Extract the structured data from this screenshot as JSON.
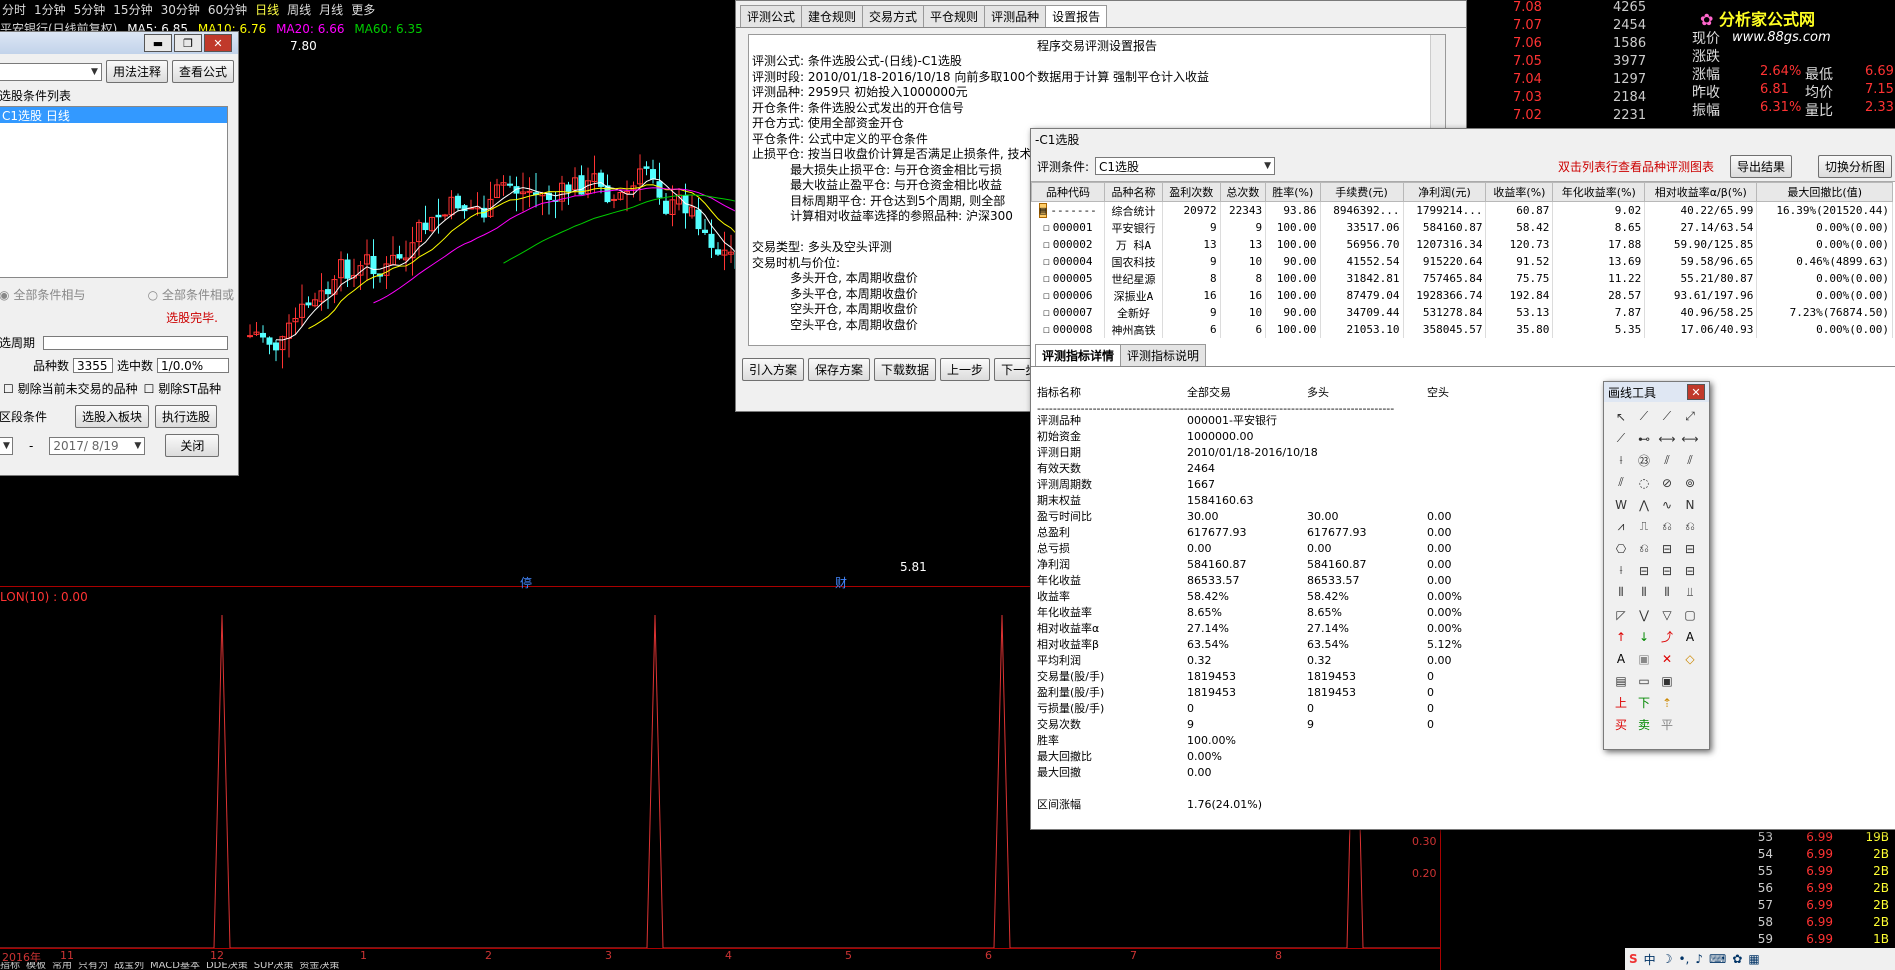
{
  "period_bar": {
    "items": [
      "分时",
      "1分钟",
      "5分钟",
      "15分钟",
      "30分钟",
      "60分钟",
      "日线",
      "周线",
      "月线",
      "更多"
    ],
    "active": "日线"
  },
  "ma_legend": {
    "title": "平安银行(日线前复权)",
    "ma5": "MA5: 6.85",
    "ma10": "MA10: 6.76",
    "ma20": "MA20: 6.66",
    "ma60": "MA60: 6.35"
  },
  "kline": {
    "high_label": "7.80",
    "low_label": "5.81",
    "date_start": "2016年",
    "months": [
      "11",
      "12",
      "1",
      "2",
      "3",
      "4",
      "5",
      "6",
      "7",
      "8"
    ],
    "event_marks": [
      "停",
      "财"
    ]
  },
  "indicator": {
    "label": "LON(10) : 0.00",
    "ticks": [
      "0.30",
      "0.20"
    ]
  },
  "bottom_tabs": [
    "指标",
    "模板",
    "常用",
    "只有为",
    "战宝列",
    "MACD基本",
    "DDE决策",
    "SUP决策",
    "资金决策"
  ],
  "select_window": {
    "buttons": {
      "usage": "用法注释",
      "view": "查看公式",
      "add": "选股入板块",
      "exec": "执行选股",
      "close": "关闭"
    },
    "list_header": "选股条件列表",
    "list_item": "C1选股  日线",
    "radio_and": "全部条件相与",
    "radio_or": "全部条件相或",
    "status": "选股完毕.",
    "period_label": "选周期",
    "count_label": "品种数",
    "count_value": "3355",
    "selected_label": "选中数",
    "selected_value": "1/0.0%",
    "check1": "剔除当前未交易的品种",
    "check2": "剔除ST品种",
    "cond_label": "区段条件",
    "dash": "-",
    "date_end": "2017/ 8/19"
  },
  "report_window": {
    "tabs": [
      "评测公式",
      "建仓规则",
      "交易方式",
      "平仓规则",
      "评测品种",
      "设置报告"
    ],
    "active_tab": "设置报告",
    "heading": "程序交易评测设置报告",
    "lines": [
      "评测公式: 条件选股公式-(日线)-C1选股",
      "评测时段: 2010/01/18-2016/10/18 向前多取100个数据用于计算 强制平仓计入收益",
      "评测品种: 2959只 初始投入1000000元",
      "开仓条件: 条件选股公式发出的开仓信号",
      "开仓方式: 使用全部资金开仓",
      "平仓条件: 公式中定义的平仓条件",
      "止损平仓: 按当日收盘价计算是否满足止损条件, 技术",
      "          最大损失止损平仓: 与开仓资金相比亏损",
      "          最大收益止盈平仓: 与开仓资金相比收益",
      "          目标周期平仓: 开仓达到5个周期, 则全部",
      "          计算相对收益率选择的参照品种: 沪深300",
      "",
      "交易类型: 多头及空头评测",
      "交易时机与价位:",
      "          多头开仓, 本周期收盘价",
      "          多头平仓, 本周期收盘价",
      "          空头开仓, 本周期收盘价",
      "          空头平仓, 本周期收盘价"
    ],
    "buttons": [
      "引入方案",
      "保存方案",
      "下载数据",
      "上一步",
      "下一步"
    ]
  },
  "result_window": {
    "title": "-C1选股",
    "cond_label": "评测条件:",
    "cond_value": "C1选股",
    "hint": "双击列表行查看品种评测图表",
    "export": "导出结果",
    "switch": "切换分析图",
    "columns": [
      "品种代码",
      "品种名称",
      "盈利次数",
      "总次数",
      "胜率(%)",
      "手续费(元)",
      "净利润(元)",
      "收益率(%)",
      "年化收益率(%)",
      "相对收益率α/β(%)",
      "最大回撤比(值)"
    ],
    "rows": [
      [
        "-------",
        "综合统计",
        "20972",
        "22343",
        "93.86",
        "8946392...",
        "1799214...",
        "60.87",
        "9.02",
        "40.22/65.99",
        "16.39%(201520.44)"
      ],
      [
        "000001",
        "平安银行",
        "9",
        "9",
        "100.00",
        "33517.06",
        "584160.87",
        "58.42",
        "8.65",
        "27.14/63.54",
        "0.00%(0.00)"
      ],
      [
        "000002",
        "万 科A",
        "13",
        "13",
        "100.00",
        "56956.70",
        "1207316.34",
        "120.73",
        "17.88",
        "59.90/125.85",
        "0.00%(0.00)"
      ],
      [
        "000004",
        "国农科技",
        "9",
        "10",
        "90.00",
        "41552.54",
        "915220.64",
        "91.52",
        "13.69",
        "59.58/96.65",
        "0.46%(4899.63)"
      ],
      [
        "000005",
        "世纪星源",
        "8",
        "8",
        "100.00",
        "31842.81",
        "757465.84",
        "75.75",
        "11.22",
        "55.21/80.87",
        "0.00%(0.00)"
      ],
      [
        "000006",
        "深振业A",
        "16",
        "16",
        "100.00",
        "87479.04",
        "1928366.74",
        "192.84",
        "28.57",
        "93.61/197.96",
        "0.00%(0.00)"
      ],
      [
        "000007",
        "全新好",
        "9",
        "10",
        "90.00",
        "34709.44",
        "531278.84",
        "53.13",
        "7.87",
        "40.96/58.25",
        "7.23%(76874.50)"
      ],
      [
        "000008",
        "神州高铁",
        "6",
        "6",
        "100.00",
        "21053.10",
        "358045.57",
        "35.80",
        "5.35",
        "17.06/40.93",
        "0.00%(0.00)"
      ]
    ],
    "tabs2": [
      "评测指标详情",
      "评测指标说明"
    ],
    "detail_header": [
      "指标名称",
      "全部交易",
      "多头",
      "空头"
    ],
    "divider": "------------------------------------------------------------------------------------------",
    "detail_rows": [
      [
        "评测品种",
        "000001-平安银行",
        "",
        ""
      ],
      [
        "初始资金",
        "1000000.00",
        "",
        ""
      ],
      [
        "评测日期",
        "2010/01/18-2016/10/18",
        "",
        ""
      ],
      [
        "有效天数",
        "2464",
        "",
        ""
      ],
      [
        "评测周期数",
        "1667",
        "",
        ""
      ],
      [
        "期末权益",
        "1584160.63",
        "",
        ""
      ],
      [
        "盈亏时间比",
        "30.00",
        "30.00",
        "0.00"
      ],
      [
        "总盈利",
        "617677.93",
        "617677.93",
        "0.00"
      ],
      [
        "总亏损",
        "0.00",
        "0.00",
        "0.00"
      ],
      [
        "净利润",
        "584160.87",
        "584160.87",
        "0.00"
      ],
      [
        "年化收益",
        "86533.57",
        "86533.57",
        "0.00"
      ],
      [
        "收益率",
        "58.42%",
        "58.42%",
        "0.00%"
      ],
      [
        "年化收益率",
        "8.65%",
        "8.65%",
        "0.00%"
      ],
      [
        "相对收益率α",
        "27.14%",
        "27.14%",
        "0.00%"
      ],
      [
        "相对收益率β",
        "63.54%",
        "63.54%",
        "5.12%"
      ],
      [
        "平均利润",
        "0.32",
        "0.32",
        "0.00"
      ],
      [
        "交易量(股/手)",
        "1819453",
        "1819453",
        "0"
      ],
      [
        "盈利量(股/手)",
        "1819453",
        "1819453",
        "0"
      ],
      [
        "亏损量(股/手)",
        "0",
        "0",
        "0"
      ],
      [
        "交易次数",
        "9",
        "9",
        "0"
      ],
      [
        "胜率",
        "100.00%",
        "",
        ""
      ],
      [
        "最大回撤比",
        "0.00%",
        "",
        ""
      ],
      [
        "最大回撤",
        "0.00",
        "",
        ""
      ],
      [
        "",
        "",
        " ",
        ""
      ],
      [
        "区间涨幅",
        "1.76(24.01%)",
        "",
        ""
      ]
    ]
  },
  "draw_tools": {
    "title": "画线工具",
    "rows_text": [
      "上",
      "下",
      "买",
      "卖",
      "平",
      "A"
    ]
  },
  "quote": {
    "prices": [
      "7.08",
      "7.07",
      "7.06",
      "7.05",
      "7.04",
      "7.03",
      "7.02"
    ],
    "vols": [
      "4265",
      "2454",
      "1586",
      "3977",
      "1297",
      "2184",
      "2231"
    ],
    "labels": [
      "现价",
      "涨跌",
      "涨幅",
      "昨收",
      "振幅"
    ],
    "labels2": [
      "",
      "",
      "最低",
      "均价",
      "量比"
    ],
    "vals1": [
      "",
      "",
      "2.64%",
      "6.81",
      "6.31%"
    ],
    "vals2": [
      "",
      "",
      "6.69",
      "7.15",
      "2.33"
    ],
    "logo_text": "分析家公式网",
    "logo_url": "www.88gs.com"
  },
  "ticks": {
    "rows": [
      [
        "53",
        "6.99",
        "19B"
      ],
      [
        "54",
        "6.99",
        "2B"
      ],
      [
        "55",
        "6.99",
        "2B"
      ],
      [
        "56",
        "6.99",
        "2B"
      ],
      [
        "57",
        "6.99",
        "2B"
      ],
      [
        "58",
        "6.99",
        "2B"
      ],
      [
        "59",
        "6.99",
        "1B"
      ]
    ],
    "partial_row": [
      "",
      "6.99",
      "1B"
    ]
  },
  "colors": {
    "up": "#ff3333",
    "down": "#54ffff",
    "ma5": "#ffffff",
    "ma10": "#ffff00",
    "ma20": "#ff00ff",
    "ma60": "#00cc00"
  }
}
